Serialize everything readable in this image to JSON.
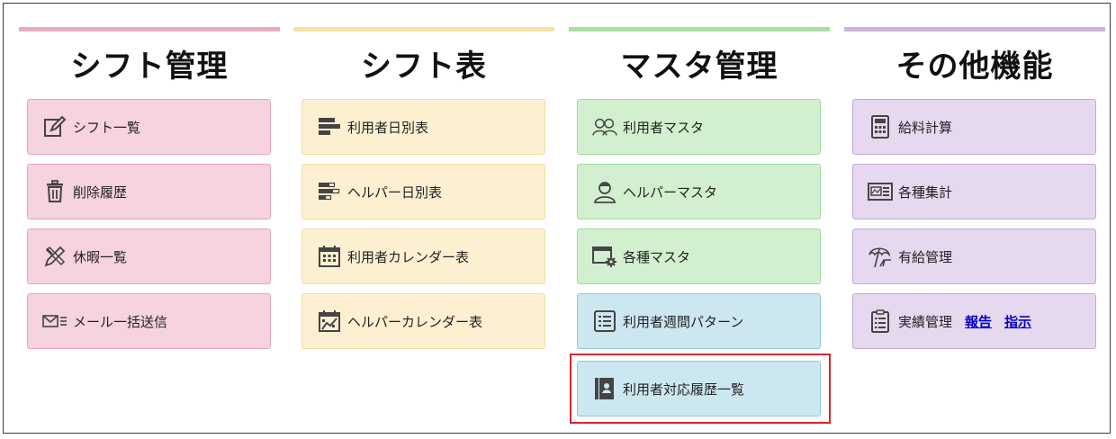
{
  "colors": {
    "pink": "#e6a7ba",
    "yellow": "#f6e2a8",
    "green": "#a8dfa2",
    "purple": "#cdb2dc",
    "highlight": "#d8252a"
  },
  "columns": [
    {
      "title": "シフト管理",
      "bar_color": "#e6aeba",
      "items": [
        {
          "label": "シフト一覧",
          "icon": "edit-icon"
        },
        {
          "label": "削除履歴",
          "icon": "trash-icon"
        },
        {
          "label": "休暇一覧",
          "icon": "pencil-ruler-icon"
        },
        {
          "label": "メール一括送信",
          "icon": "mail-icon"
        }
      ]
    },
    {
      "title": "シフト表",
      "bar_color": "#f6e2a8",
      "items": [
        {
          "label": "利用者日別表",
          "icon": "bar-chart-icon"
        },
        {
          "label": "ヘルパー日別表",
          "icon": "bar-chart-outline-icon"
        },
        {
          "label": "利用者カレンダー表",
          "icon": "calendar-icon"
        },
        {
          "label": "ヘルパーカレンダー表",
          "icon": "calendar-chart-icon"
        }
      ]
    },
    {
      "title": "マスタ管理",
      "bar_color": "#a8dfa2",
      "items": [
        {
          "label": "利用者マスタ",
          "icon": "users-icon"
        },
        {
          "label": "ヘルパーマスタ",
          "icon": "user-icon"
        },
        {
          "label": "各種マスタ",
          "icon": "window-gear-icon"
        },
        {
          "label": "利用者週間パターン",
          "icon": "list-icon"
        },
        {
          "label": "利用者対応履歴一覧",
          "icon": "contact-book-icon"
        }
      ]
    },
    {
      "title": "その他機能",
      "bar_color": "#cdb2dc",
      "items": [
        {
          "label": "給料計算",
          "icon": "calculator-icon"
        },
        {
          "label": "各種集計",
          "icon": "dashboard-icon"
        },
        {
          "label": "有給管理",
          "icon": "beach-umbrella-icon"
        },
        {
          "label": "実績管理",
          "icon": "clipboard-icon",
          "links": [
            "報告",
            "指示"
          ]
        }
      ]
    }
  ]
}
